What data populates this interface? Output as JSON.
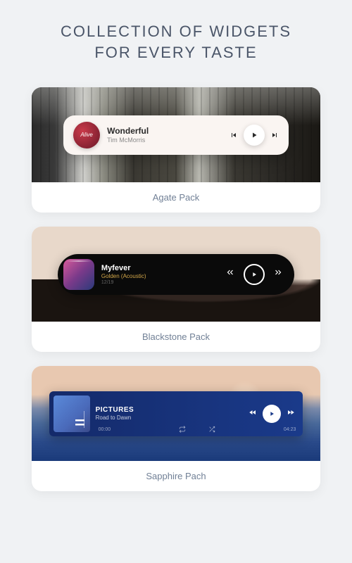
{
  "heading": "COLLECTION OF WIDGETS\nFOR EVERY TASTE",
  "cards": [
    {
      "name": "Agate Pack",
      "widget": {
        "art_text": "Alive",
        "title": "Wonderful",
        "artist": "Tim McMorris"
      }
    },
    {
      "name": "Blackstone Pack",
      "widget": {
        "title": "Myfever",
        "artist": "Golden (Acoustic)",
        "date": "12/19"
      }
    },
    {
      "name": "Sapphire Pach",
      "widget": {
        "title": "PICTURES",
        "artist": "Road to Dawn",
        "time_elapsed": "00:00",
        "time_total": "04:23"
      }
    }
  ]
}
